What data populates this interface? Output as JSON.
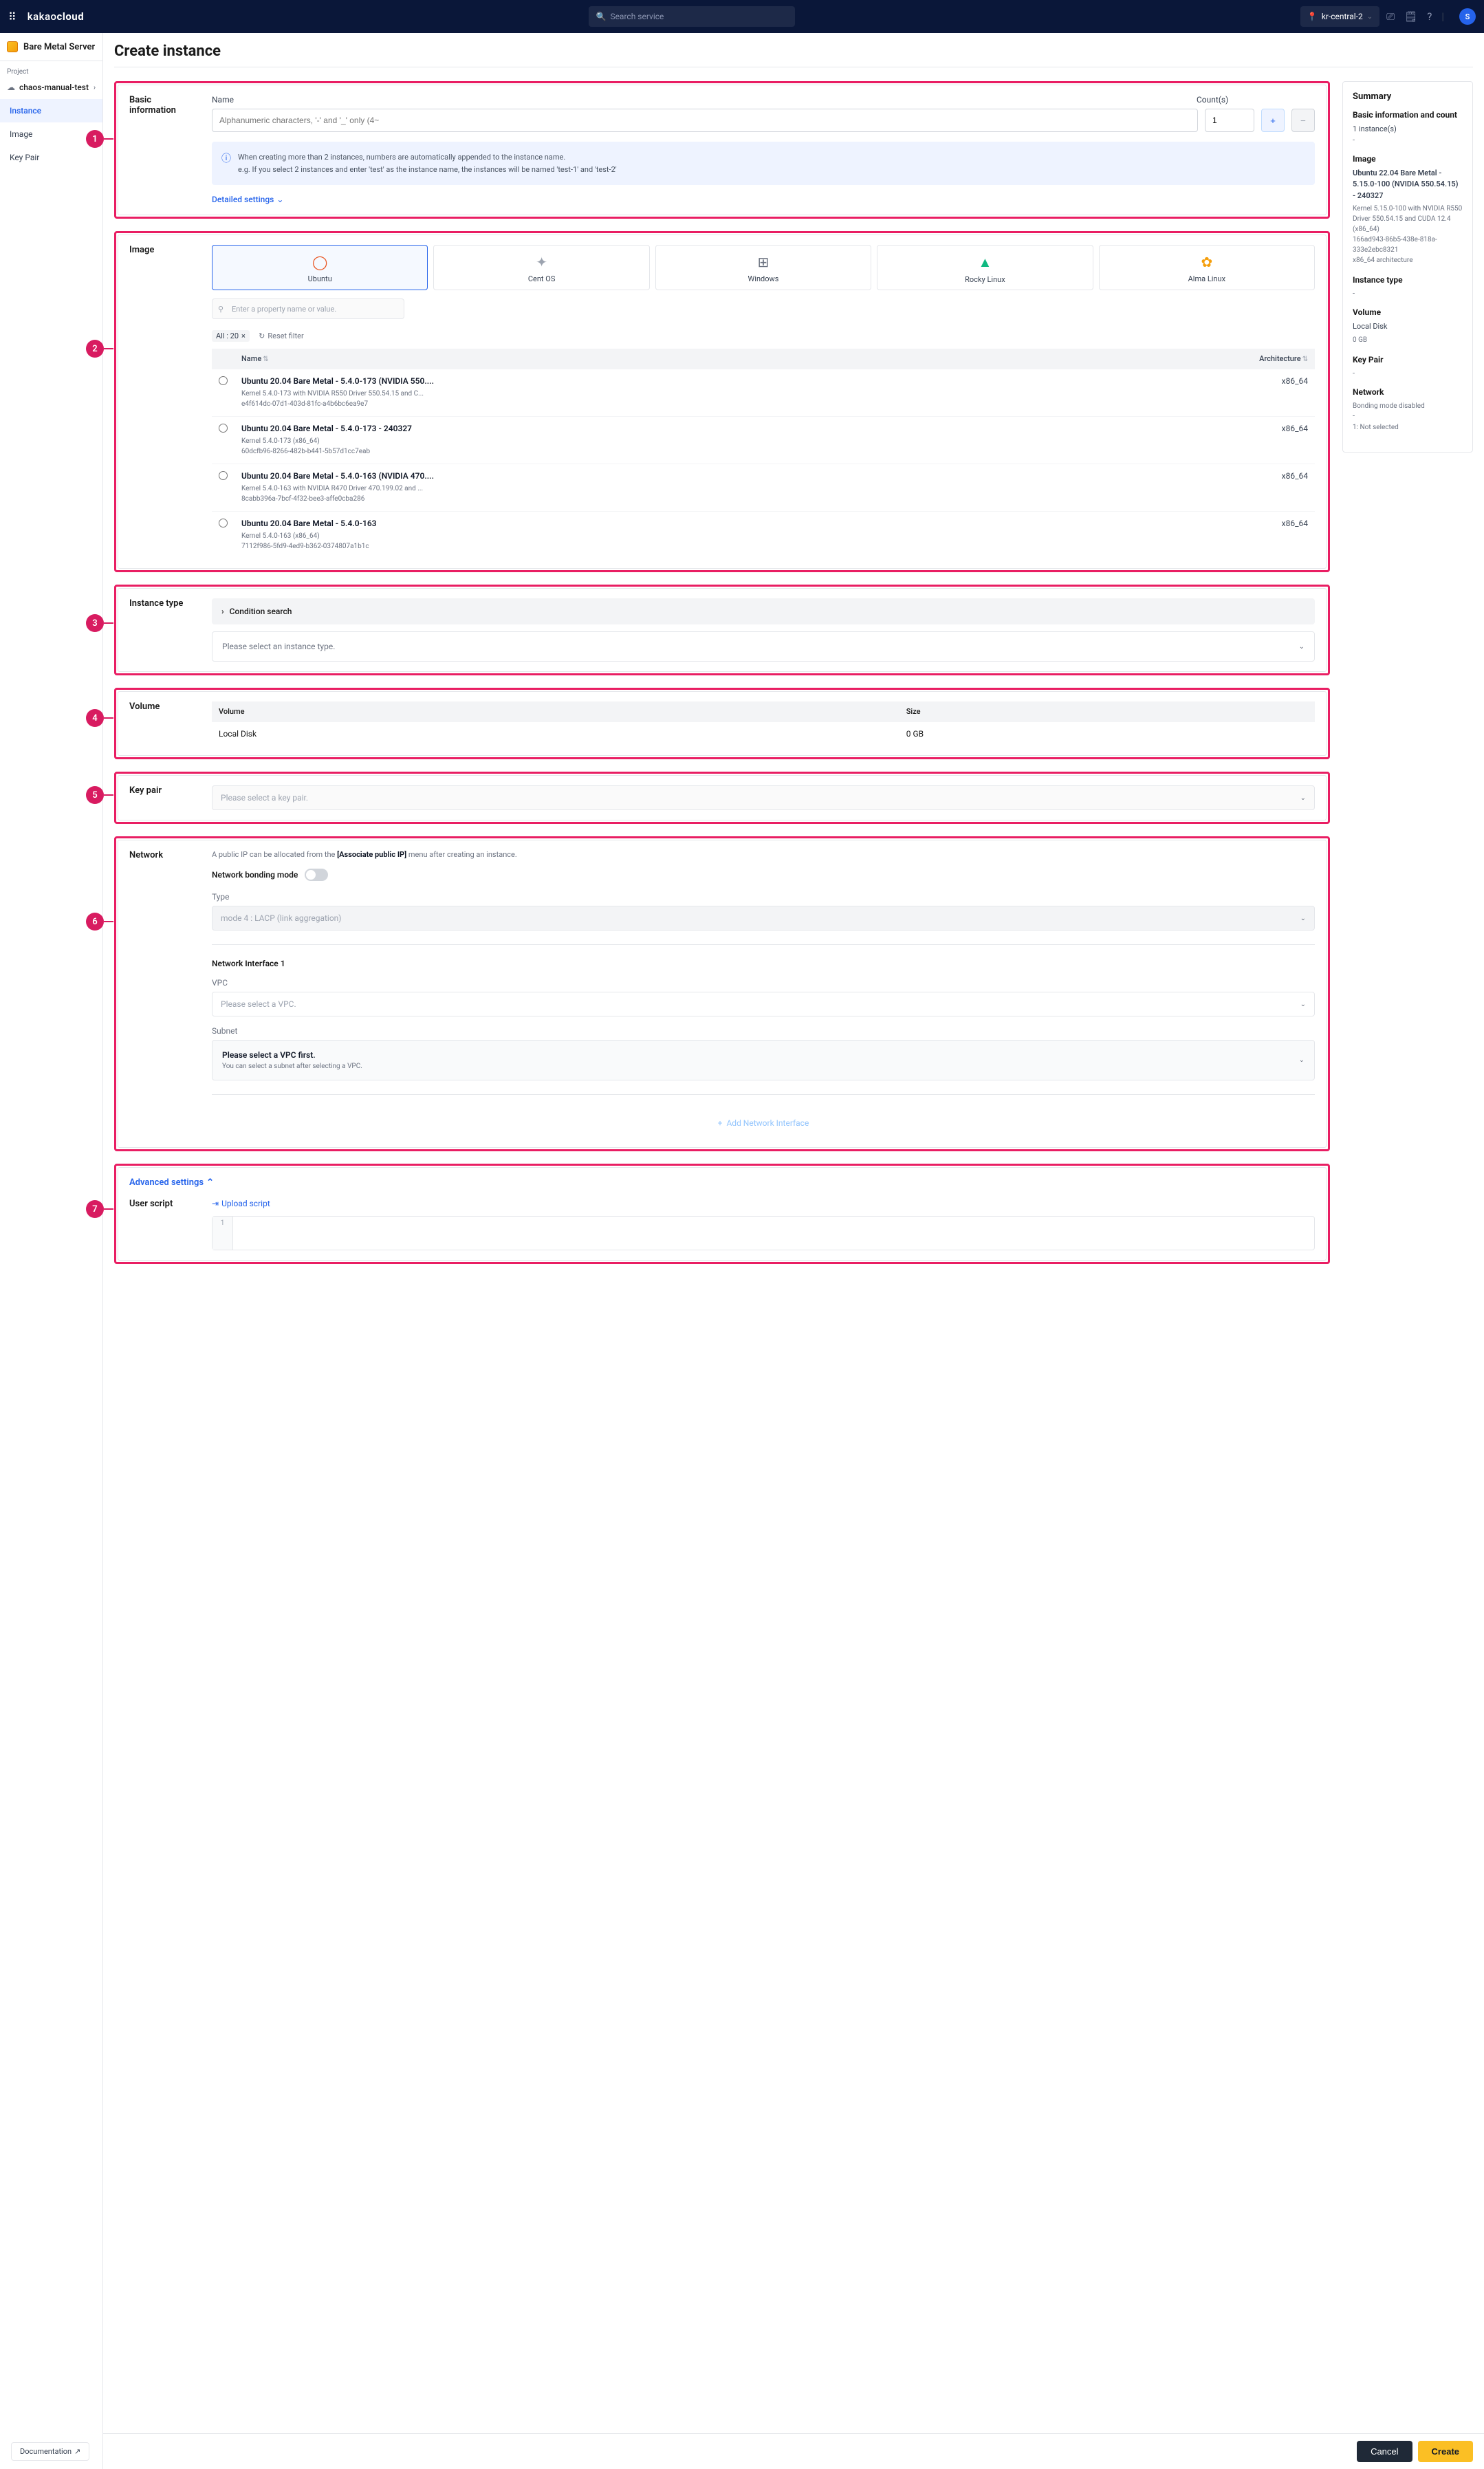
{
  "header": {
    "logo_prefix": "kakao",
    "logo_suffix": "cloud",
    "search_placeholder": "Search service",
    "region": "kr-central-2",
    "avatar_letter": "S"
  },
  "sidebar": {
    "title": "Bare Metal Server",
    "project_label": "Project",
    "project_name": "chaos-manual-test",
    "items": [
      "Instance",
      "Image",
      "Key Pair"
    ]
  },
  "page_title": "Create instance",
  "sections": {
    "basic": {
      "title": "Basic information",
      "name_label": "Name",
      "count_label": "Count(s)",
      "name_placeholder": "Alphanumeric characters, '-' and '_' only (4~",
      "count_value": "1",
      "info_line1": "When creating more than 2 instances, numbers are automatically appended to the instance name.",
      "info_line2": "e.g. If you select 2 instances and enter 'test' as the instance name, the instances will be named 'test-1' and 'test-2'",
      "detailed_link": "Detailed settings"
    },
    "image": {
      "title": "Image",
      "os": [
        "Ubuntu",
        "Cent OS",
        "Windows",
        "Rocky Linux",
        "Alma Linux"
      ],
      "filter_placeholder": "Enter a property name or value.",
      "chip": "All : 20",
      "reset": "Reset filter",
      "col_name": "Name",
      "col_arch": "Architecture",
      "rows": [
        {
          "name": "Ubuntu 20.04 Bare Metal - 5.4.0-173 (NVIDIA 550....",
          "sub": "Kernel 5.4.0-173 with NVIDIA R550 Driver 550.54.15 and C...\ne4f614dc-07d1-403d-81fc-a4b6bc6ea9e7",
          "arch": "x86_64"
        },
        {
          "name": "Ubuntu 20.04 Bare Metal - 5.4.0-173 - 240327",
          "sub": "Kernel 5.4.0-173 (x86_64)\n60dcfb96-8266-482b-b441-5b57d1cc7eab",
          "arch": "x86_64"
        },
        {
          "name": "Ubuntu 20.04 Bare Metal - 5.4.0-163 (NVIDIA 470....",
          "sub": "Kernel 5.4.0-163 with NVIDIA R470 Driver 470.199.02 and ...\n8cabb396a-7bcf-4f32-bee3-affe0cba286",
          "arch": "x86_64"
        },
        {
          "name": "Ubuntu 20.04 Bare Metal - 5.4.0-163",
          "sub": "Kernel 5.4.0-163 (x86_64)\n7112f986-5fd9-4ed9-b362-0374807a1b1c",
          "arch": "x86_64"
        }
      ]
    },
    "instance_type": {
      "title": "Instance type",
      "cond": "Condition search",
      "select_ph": "Please select an instance type."
    },
    "volume": {
      "title": "Volume",
      "col_vol": "Volume",
      "col_size": "Size",
      "row_vol": "Local Disk",
      "row_size": "0 GB"
    },
    "keypair": {
      "title": "Key pair",
      "placeholder": "Please select a key pair."
    },
    "network": {
      "title": "Network",
      "note_pre": "A public IP can be allocated from the ",
      "note_bold": "[Associate public IP]",
      "note_post": " menu after creating an instance.",
      "bonding_label": "Network bonding mode",
      "type_label": "Type",
      "type_value": "mode 4 : LACP (link aggregation)",
      "iface_title": "Network Interface 1",
      "vpc_label": "VPC",
      "vpc_placeholder": "Please select a VPC.",
      "subnet_label": "Subnet",
      "subnet_title": "Please select a VPC first.",
      "subnet_desc": "You can select a subnet after selecting a VPC.",
      "add_iface": "Add Network Interface"
    },
    "advanced": {
      "link": "Advanced settings",
      "userscript_label": "User script",
      "upload": "Upload script",
      "line_num": "1"
    }
  },
  "summary": {
    "title": "Summary",
    "basic_title": "Basic information and count",
    "basic_val": "1 instance(s)",
    "dash": "-",
    "image_title": "Image",
    "image_name": "Ubuntu 22.04 Bare Metal - 5.15.0-100 (NVIDIA 550.54.15) - 240327",
    "image_sub": "Kernel 5.15.0-100 with NVIDIA R550 Driver 550.54.15 and CUDA 12.4 (x86_64)\n166ad943-86b5-438e-818a-333e2ebc8321\nx86_64 architecture",
    "itype_title": "Instance type",
    "vol_title": "Volume",
    "vol_name": "Local Disk",
    "vol_size": "0 GB",
    "kp_title": "Key Pair",
    "net_title": "Network",
    "net_bonding": "Bonding mode disabled",
    "net_iface": "1: Not selected"
  },
  "footer": {
    "cancel": "Cancel",
    "create": "Create",
    "docs": "Documentation"
  }
}
